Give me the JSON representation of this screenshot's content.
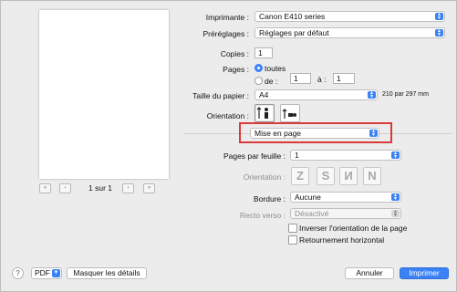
{
  "preview": {
    "page_indicator": "1 sur 1",
    "first_label": "«",
    "prev_label": "‹",
    "next_label": "›",
    "last_label": "»"
  },
  "printer": {
    "label": "Imprimante :",
    "value": "Canon E410 series"
  },
  "presets": {
    "label": "Préréglages :",
    "value": "Réglages par défaut"
  },
  "copies": {
    "label": "Copies :",
    "value": "1"
  },
  "pages": {
    "label": "Pages :",
    "all_label": "toutes",
    "from_label": "de :",
    "from_value": "1",
    "to_label": "à :",
    "to_value": "1",
    "selected": "toutes"
  },
  "paper_size": {
    "label": "Taille du papier :",
    "value": "A4",
    "dimensions": "210 par 297 mm"
  },
  "orientation": {
    "label": "Orientation :",
    "selected": "portrait"
  },
  "section": {
    "value": "Mise en page"
  },
  "layout": {
    "pages_per_sheet_label": "Pages par feuille :",
    "pages_per_sheet_value": "1",
    "layout_direction_label": "Orientation :",
    "direction_glyphs": [
      "Z",
      "S",
      "N",
      "N"
    ],
    "border_label": "Bordure :",
    "border_value": "Aucune",
    "two_sided_label": "Recto verso :",
    "two_sided_value": "Désactivé",
    "reverse_label": "Inverser l'orientation de la page",
    "reverse_checked": false,
    "flip_label": "Retournement horizontal",
    "flip_checked": false
  },
  "footer": {
    "help_label": "?",
    "pdf_label": "PDF",
    "hide_details_label": "Masquer les détails",
    "cancel_label": "Annuler",
    "print_label": "Imprimer"
  },
  "colors": {
    "accent": "#3b82f6",
    "highlight": "#d93a3a"
  }
}
